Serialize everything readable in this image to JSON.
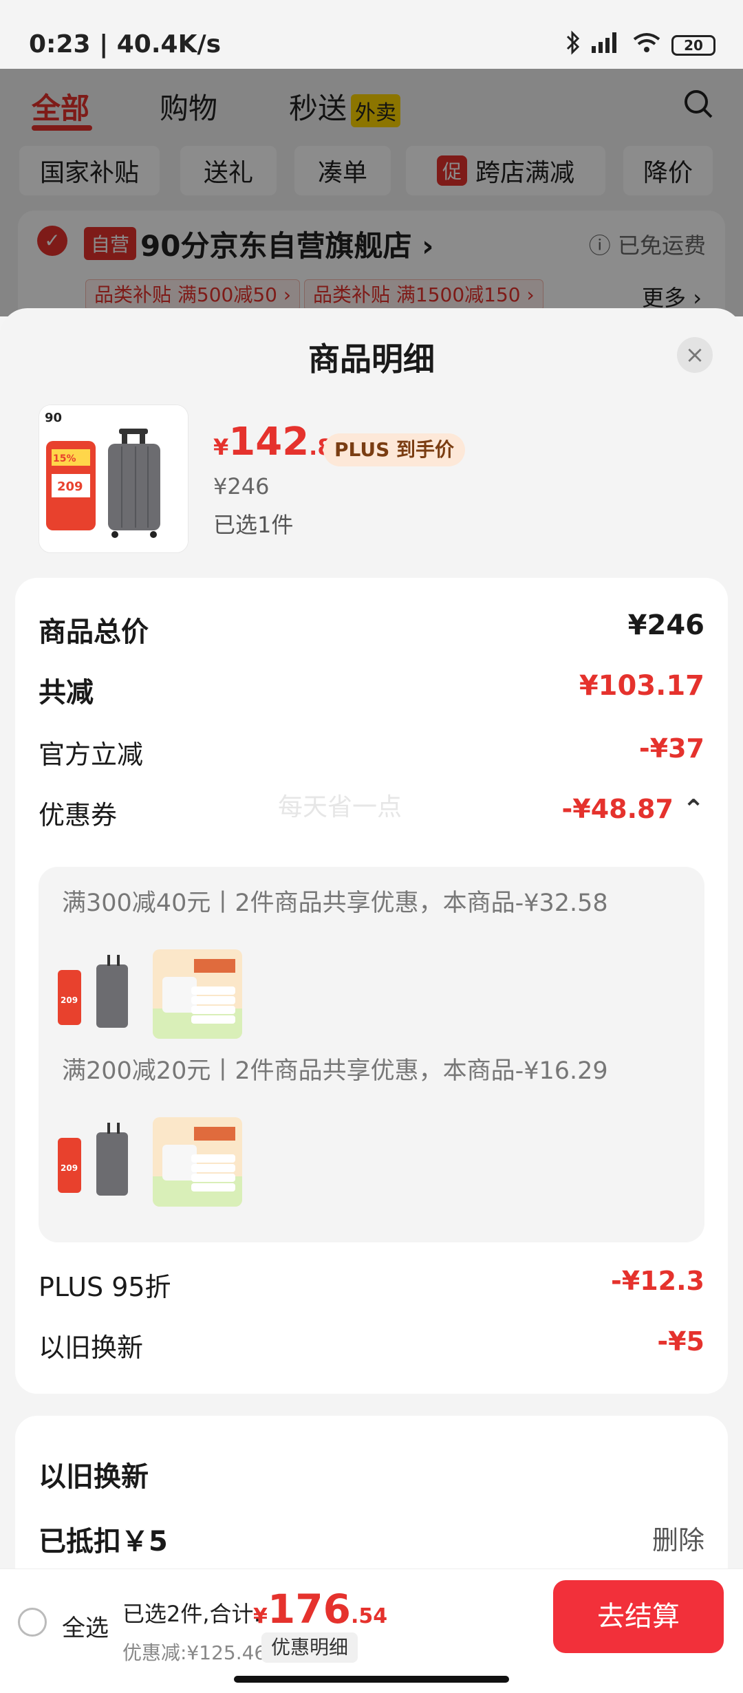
{
  "status": {
    "time": "0:23 | 40.4K/s",
    "battery": "20"
  },
  "tabs": [
    {
      "label": "全部"
    },
    {
      "label": "购物"
    },
    {
      "label": "秒送",
      "badge": "外卖"
    }
  ],
  "chips": [
    "国家补贴",
    "送礼",
    "凑单",
    "跨店满减",
    "降价"
  ],
  "chips_badge": "促",
  "store": {
    "tag": "自营",
    "name": "90分京东自营旗舰店",
    "chevron": "›",
    "shipping": "已免运费",
    "promos": [
      "品类补贴 满500减50 ›",
      "品类补贴 满1500减150 ›"
    ],
    "more": "更多 ›"
  },
  "sheet": {
    "title": "商品明细",
    "close": "×",
    "product": {
      "price_yen": "¥",
      "price_int": "142",
      "price_dec": ".83",
      "plus_tag": "PLUS 到手价",
      "orig_price": "¥246",
      "selected": "已选1件"
    }
  },
  "breakdown": {
    "total_label": "商品总价",
    "total_value": "¥246",
    "reduce_label": "共减",
    "reduce_value": "¥103.17",
    "official_label": "官方立减",
    "official_value": "-¥37",
    "coupon_label": "优惠券",
    "coupon_value": "-¥48.87",
    "coupon_chevron": "⌃",
    "watermark": "每天省一点",
    "coupons": [
      {
        "text": "满300减40元丨2件商品共享优惠，本商品-¥32.58"
      },
      {
        "text": "满200减20元丨2件商品共享优惠，本商品-¥16.29"
      }
    ],
    "plus_label": "PLUS 95折",
    "plus_value": "-¥12.3",
    "tradein_label": "以旧换新",
    "tradein_value": "-¥5"
  },
  "tradein_card": {
    "title": "以旧换新",
    "deducted": "已抵扣￥5",
    "delete": "删除"
  },
  "bottom": {
    "select_all": "全选",
    "sum_label": "已选2件,合计:",
    "sum_yen": "¥",
    "sum_int": "176",
    "sum_dec": ".54",
    "discount": "优惠减:¥125.46",
    "detail": "优惠明细",
    "checkout": "去结算"
  },
  "colors": {
    "accent": "#e5322d",
    "checkout": "#f2303a"
  }
}
